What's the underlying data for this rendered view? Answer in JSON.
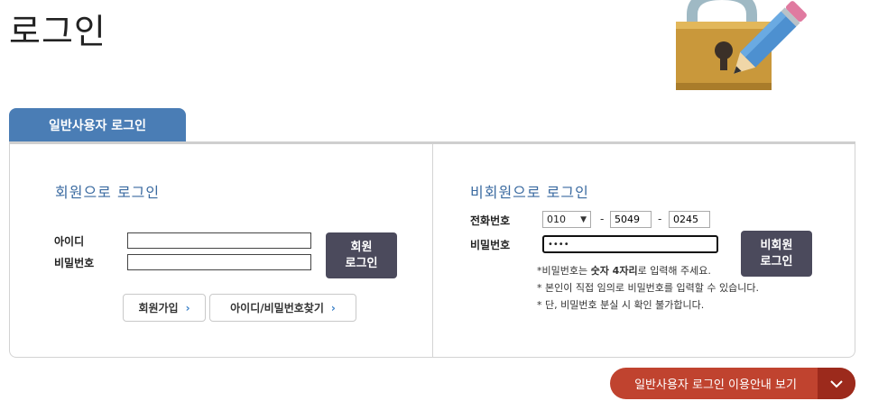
{
  "page": {
    "title": "로그인"
  },
  "tabs": [
    {
      "label": "일반사용자 로그인"
    }
  ],
  "member": {
    "title": "회원으로 로그인",
    "id_label": "아이디",
    "pw_label": "비밀번호",
    "id_value": "",
    "pw_value": "",
    "login_button_line1": "회원",
    "login_button_line2": "로그인",
    "signup_button": "회원가입",
    "find_button": "아이디/비밀번호찾기"
  },
  "guest": {
    "title": "비회원으로 로그인",
    "phone_label": "전화번호",
    "pw_label": "비밀번호",
    "phone_prefix": "010",
    "phone_mid": "5049",
    "phone_last": "0245",
    "dash": "-",
    "pw_value": "••••",
    "login_button_line1": "비회원",
    "login_button_line2": "로그인",
    "notes": [
      {
        "pre": "*비밀번호는 ",
        "bold": "숫자 4자리",
        "post": "로 입력해 주세요."
      },
      {
        "pre": "* 본인이 직접 임의로 비밀번호를 입력할 수 있습니다.",
        "bold": "",
        "post": ""
      },
      {
        "pre": "* 단, 비밀번호 분실 시 확인 불가합니다.",
        "bold": "",
        "post": ""
      }
    ]
  },
  "guide": {
    "label": "일반사용자 로그인 이용안내 보기"
  },
  "colors": {
    "tab": "#4a7db5",
    "title": "#3a6aa0",
    "dark_button": "#4b4a5c",
    "guide": "#c0432f",
    "guide_dark": "#9c2a1c"
  },
  "icons": [
    "lock-pencil-illustration",
    "chevron-right-icon",
    "chevron-down-icon"
  ]
}
